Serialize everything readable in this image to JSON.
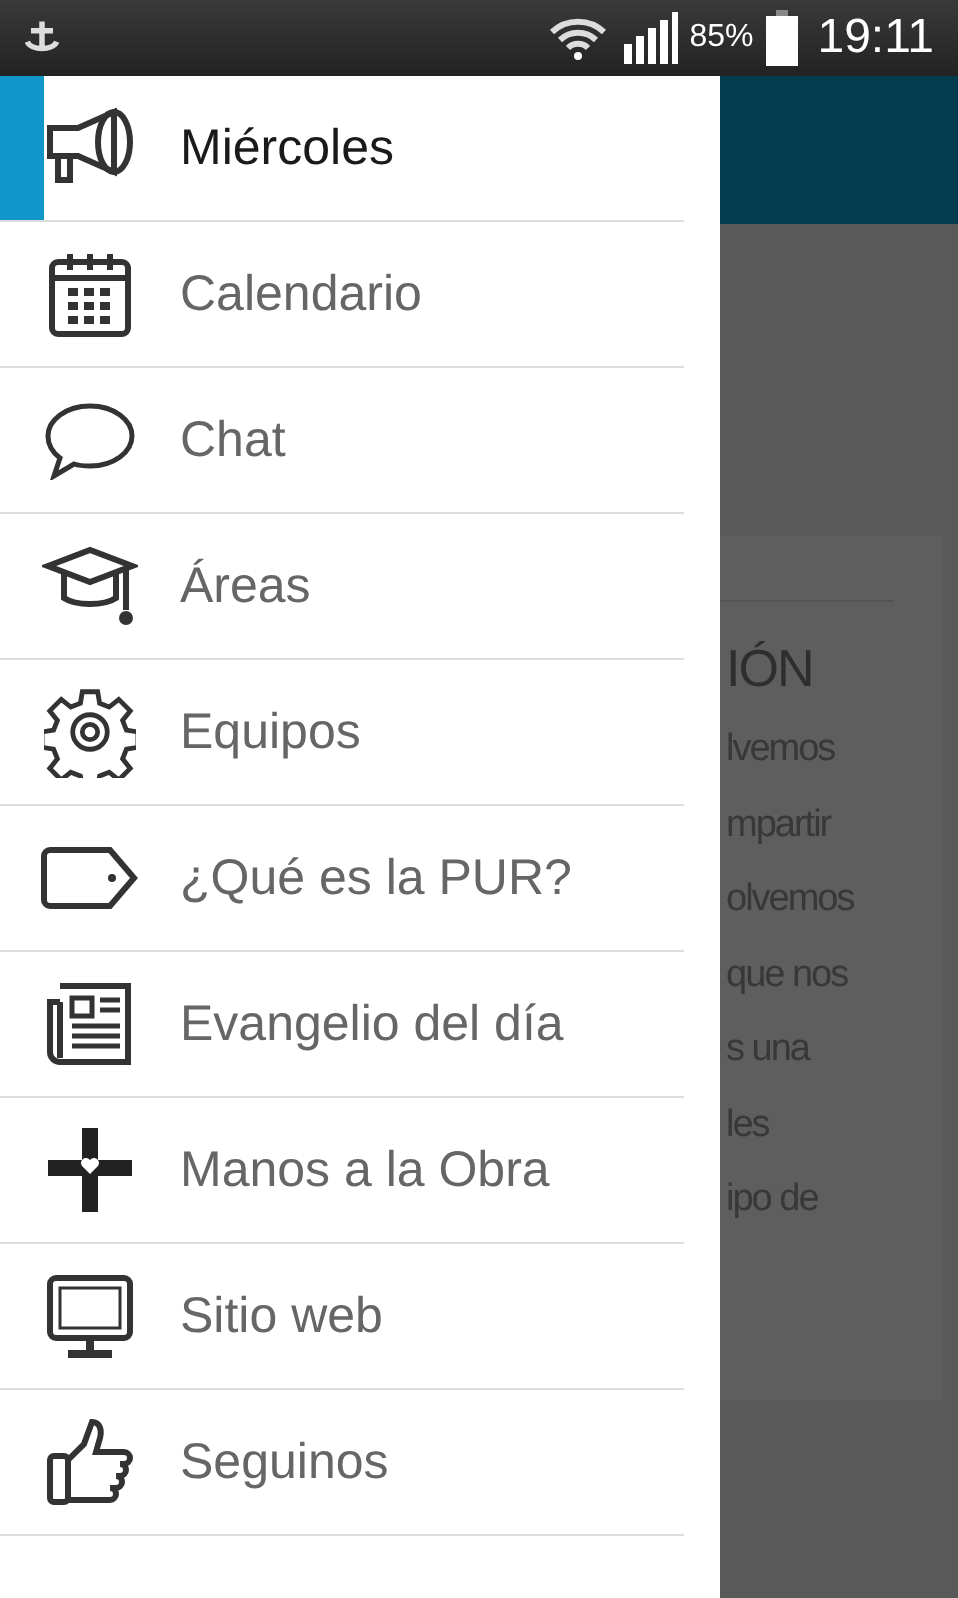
{
  "status_bar": {
    "battery": "85%",
    "time": "19:11"
  },
  "drawer": {
    "items": [
      {
        "label": "Miércoles",
        "selected": true
      },
      {
        "label": "Calendario",
        "selected": false
      },
      {
        "label": "Chat",
        "selected": false
      },
      {
        "label": "Áreas",
        "selected": false
      },
      {
        "label": "Equipos",
        "selected": false
      },
      {
        "label": "¿Qué es la PUR?",
        "selected": false
      },
      {
        "label": "Evangelio del día",
        "selected": false
      },
      {
        "label": "Manos a la Obra",
        "selected": false
      },
      {
        "label": "Sitio web",
        "selected": false
      },
      {
        "label": "Seguinos",
        "selected": false
      }
    ]
  },
  "background_card": {
    "heading": "IÓN",
    "lines": [
      "lvemos",
      "mpartir",
      "olvemos",
      "que nos",
      "s una",
      "les",
      "ipo de"
    ]
  }
}
